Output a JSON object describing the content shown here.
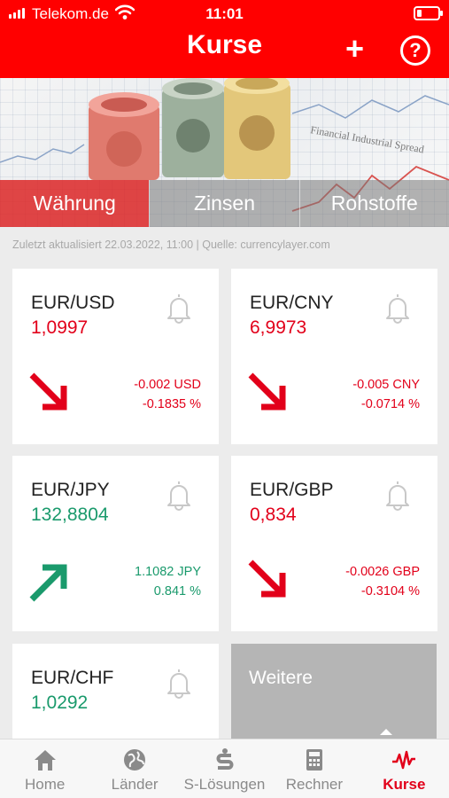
{
  "status_bar": {
    "carrier": "Telekom.de",
    "time": "11:01"
  },
  "header": {
    "title": "Kurse",
    "add_label": "+",
    "help_label": "?"
  },
  "hero": {
    "chart_caption": "Financial Industrial Spread"
  },
  "tabs": [
    {
      "label": "Währung",
      "active": true
    },
    {
      "label": "Zinsen",
      "active": false
    },
    {
      "label": "Rohstoffe",
      "active": false
    }
  ],
  "last_updated": "Zuletzt aktualisiert  22.03.2022, 11:00 | Quelle: currencylayer.com",
  "cards": [
    {
      "pair": "EUR/USD",
      "rate": "1,0997",
      "change_abs": "-0.002 USD",
      "change_pct": "-0.1835 %",
      "trend": "down"
    },
    {
      "pair": "EUR/CNY",
      "rate": "6,9973",
      "change_abs": "-0.005 CNY",
      "change_pct": "-0.0714 %",
      "trend": "down"
    },
    {
      "pair": "EUR/JPY",
      "rate": "132,8804",
      "change_abs": "1.1082 JPY",
      "change_pct": "0.841 %",
      "trend": "up"
    },
    {
      "pair": "EUR/GBP",
      "rate": "0,834",
      "change_abs": "-0.0026 GBP",
      "change_pct": "-0.3104 %",
      "trend": "down"
    },
    {
      "pair": "EUR/CHF",
      "rate": "1,0292",
      "change_abs": "",
      "change_pct": "",
      "trend": "up"
    }
  ],
  "more_label": "Weitere",
  "nav": [
    {
      "label": "Home",
      "icon": "home-icon"
    },
    {
      "label": "Länder",
      "icon": "globe-icon"
    },
    {
      "label": "S-Lösungen",
      "icon": "sparkasse-icon"
    },
    {
      "label": "Rechner",
      "icon": "calculator-icon"
    },
    {
      "label": "Kurse",
      "icon": "chart-pulse-icon",
      "active": true
    }
  ],
  "colors": {
    "brand": "#ff0000",
    "negative": "#e2001a",
    "positive": "#1a9a6c"
  }
}
